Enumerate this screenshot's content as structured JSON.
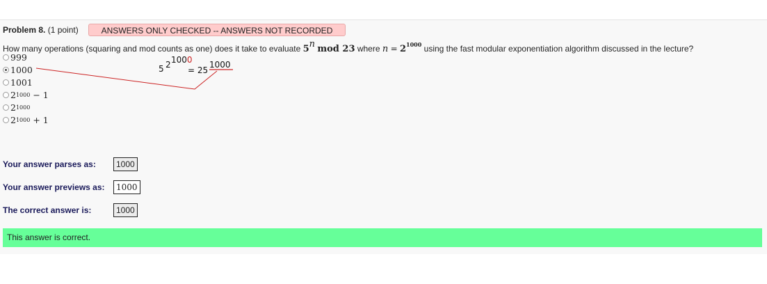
{
  "problem": {
    "title": "Problem 8.",
    "points": "(1 point)",
    "warning": "ANSWERS ONLY CHECKED -- ANSWERS NOT RECORDED",
    "question_prefix": "How many operations (squaring and mod counts as one) does it take to evaluate",
    "expr_base": "5",
    "expr_exp": "n",
    "expr_mod": "mod 23",
    "where_text": "where",
    "n_var": "n",
    "eq": "=",
    "n_base": "2",
    "n_exp": "1000",
    "question_suffix": "using the fast modular exponentiation algorithm discussed in the lecture?"
  },
  "choices": [
    {
      "base": "999",
      "exp": "",
      "tail": "",
      "selected": false
    },
    {
      "base": "1000",
      "exp": "",
      "tail": "",
      "selected": true
    },
    {
      "base": "1001",
      "exp": "",
      "tail": "",
      "selected": false
    },
    {
      "base": "2",
      "exp": "1000",
      "tail": "− 1",
      "selected": false
    },
    {
      "base": "2",
      "exp": "1000",
      "tail": "",
      "selected": false
    },
    {
      "base": "2",
      "exp": "1000",
      "tail": "+ 1",
      "selected": false
    }
  ],
  "annotation": {
    "base": "5",
    "exp_base": "2",
    "exp_exp_black": "100",
    "exp_exp_red": "0",
    "equals": "= 25",
    "result_exp": "1000"
  },
  "results": {
    "parses_label": "Your answer parses as:",
    "parses_value": "1000",
    "preview_label": "Your answer previews as:",
    "preview_value": "1000",
    "correct_label": "The correct answer is:",
    "correct_value": "1000"
  },
  "feedback": "This answer is correct.",
  "colors": {
    "warning_bg": "#ffcccc",
    "correct_bg": "#66ff99",
    "annotation_line": "#cc2222"
  }
}
